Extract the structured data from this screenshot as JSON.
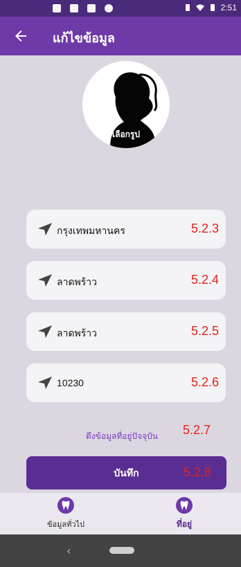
{
  "status_bar": {
    "time": "2:51"
  },
  "app_bar": {
    "title": "แก้ไขข้อมูล"
  },
  "avatar": {
    "label": "เลือกรูป"
  },
  "fields": [
    {
      "value": "กรุงเทพมหานคร",
      "code": "5.2.3"
    },
    {
      "value": "ลาดพร้าว",
      "code": "5.2.4"
    },
    {
      "value": "ลาดพร้าว",
      "code": "5.2.5"
    },
    {
      "value": "10230",
      "code": "5.2.6"
    }
  ],
  "fetch": {
    "label": "ดึงข้อมูลที่อยู่ปัจจุบัน",
    "code": "5.2.7"
  },
  "save": {
    "label": "บันทึก",
    "code": "5.2.8"
  },
  "bottom_nav": {
    "items": [
      {
        "label": "ข้อมูลทั่วไป",
        "icon": "tooth-icon",
        "active": false
      },
      {
        "label": "ที่อยู่",
        "icon": "tooth-icon",
        "active": true
      }
    ]
  },
  "colors": {
    "primary": "#6d3aa8",
    "dark": "#4a2a7a",
    "annotation": "#e0241a"
  }
}
